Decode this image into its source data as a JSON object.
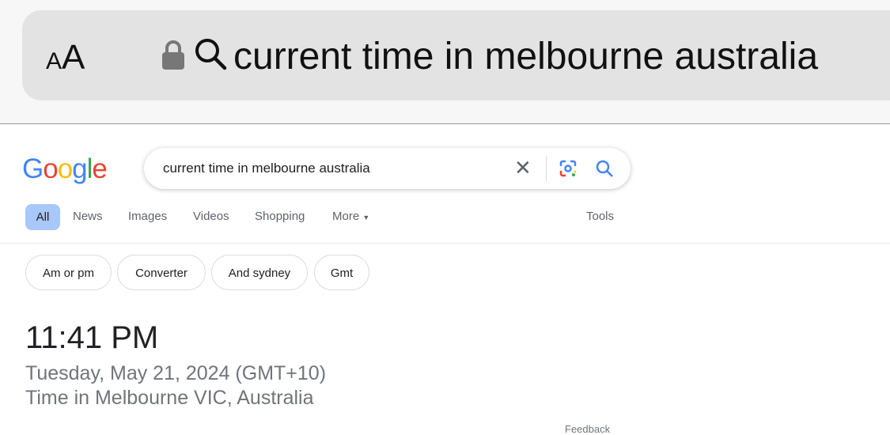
{
  "browser": {
    "text_size_label": "AA",
    "url_text": "current time in melbourne australia"
  },
  "google": {
    "logo": "Google",
    "search_value": "current time in melbourne australia",
    "tabs": [
      "All",
      "News",
      "Images",
      "Videos",
      "Shopping",
      "More"
    ],
    "tools": "Tools",
    "chips": [
      "Am or pm",
      "Converter",
      "And sydney",
      "Gmt"
    ],
    "result": {
      "time": "11:41 PM",
      "date": "Tuesday, May 21, 2024 (GMT+10)",
      "location": "Time in Melbourne VIC, Australia"
    },
    "feedback": "Feedback"
  }
}
